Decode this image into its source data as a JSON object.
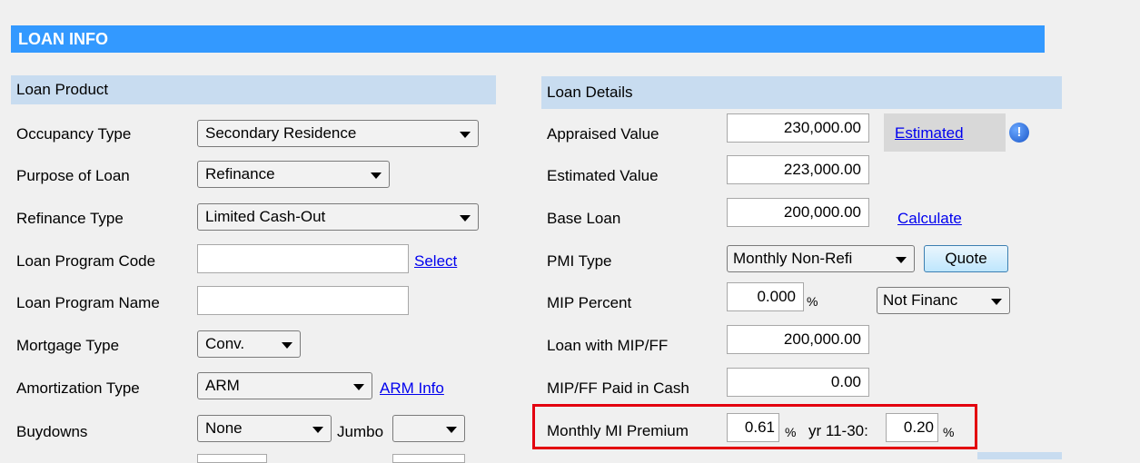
{
  "header": {
    "title": "LOAN INFO"
  },
  "loan_product": {
    "section_title": "Loan Product",
    "occupancy_type": {
      "label": "Occupancy Type",
      "value": "Secondary Residence"
    },
    "purpose_of_loan": {
      "label": "Purpose of Loan",
      "value": "Refinance"
    },
    "refinance_type": {
      "label": "Refinance Type",
      "value": "Limited Cash-Out"
    },
    "loan_program_code": {
      "label": "Loan Program Code",
      "value": "",
      "link": "Select"
    },
    "loan_program_name": {
      "label": "Loan Program Name",
      "value": ""
    },
    "mortgage_type": {
      "label": "Mortgage Type",
      "value": "Conv."
    },
    "amortization_type": {
      "label": "Amortization Type",
      "value": "ARM",
      "link": "ARM Info"
    },
    "buydowns": {
      "label": "Buydowns",
      "value": "None",
      "jumbo_label": "Jumbo",
      "jumbo_value": ""
    }
  },
  "loan_details": {
    "section_title": "Loan Details",
    "appraised_value": {
      "label": "Appraised Value",
      "value": "230,000.00",
      "link": "Estimated"
    },
    "estimated_value": {
      "label": "Estimated Value",
      "value": "223,000.00"
    },
    "base_loan": {
      "label": "Base Loan",
      "value": "200,000.00",
      "link": "Calculate"
    },
    "pmi_type": {
      "label": "PMI Type",
      "value": "Monthly Non-Refi",
      "button": "Quote"
    },
    "mip_percent": {
      "label": "MIP Percent",
      "value": "0.000",
      "unit": "%",
      "financed": "Not Financ"
    },
    "loan_with_mip": {
      "label": "Loan with MIP/FF",
      "value": "200,000.00"
    },
    "mip_paid_cash": {
      "label": "MIP/FF Paid in Cash",
      "value": "0.00"
    },
    "monthly_mi": {
      "label": "Monthly MI Premium",
      "value": "0.61",
      "unit": "%",
      "yr_label": "yr 11-30:",
      "yr_value": "0.20",
      "yr_unit": "%"
    }
  },
  "colors": {
    "header": "#3399ff",
    "section": "#c8dcf0",
    "highlight": "#e3000f"
  }
}
